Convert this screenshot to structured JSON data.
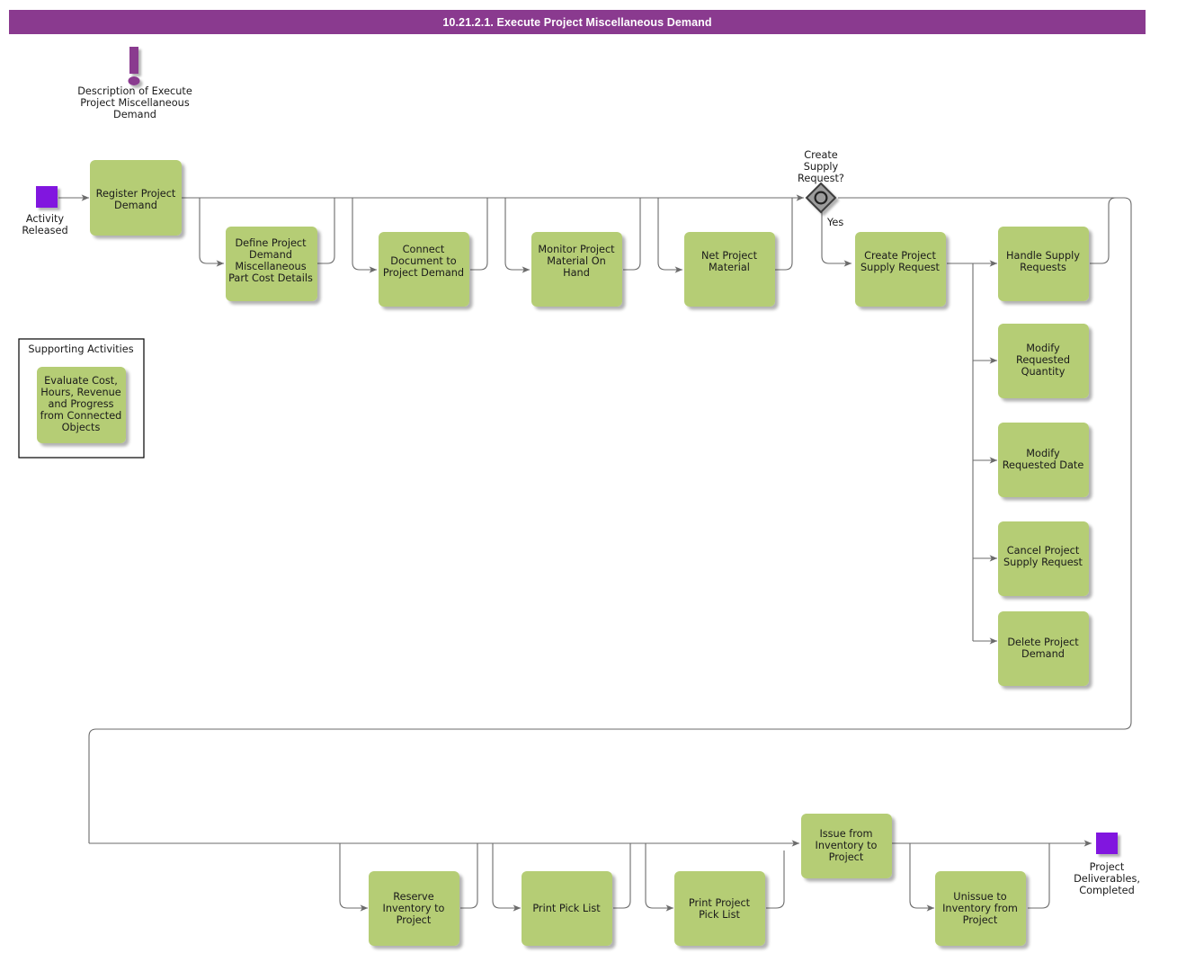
{
  "header": {
    "title": "10.21.2.1. Execute Project Miscellaneous Demand",
    "bar_color": "#8A3A8F",
    "text_color": "#FFFFFF"
  },
  "theme": {
    "task_fill": "#B5CD74",
    "event_fill": "#8117DF",
    "gateway_fill": "#9C9C9C",
    "gateway_stroke": "#3C3C3C",
    "line_color": "#6B6B6B",
    "annotation_color": "#8A3A8F",
    "background": "#FFFFFF"
  },
  "annotation": {
    "icon": "exclamation-mark-icon",
    "label": "Description of Execute Project Miscellaneous Demand",
    "lines": [
      "Description of Execute",
      "Project Miscellaneous",
      "Demand"
    ]
  },
  "start_event": {
    "name": "activity-released",
    "label": "Activity Released",
    "lines": [
      "Activity",
      "Released"
    ]
  },
  "end_event": {
    "name": "project-deliverables-completed",
    "label": "Project Deliverables, Completed",
    "lines": [
      "Project",
      "Deliverables,",
      "Completed"
    ]
  },
  "gateway": {
    "name": "create-supply-request-gateway",
    "label": "Create Supply Request?",
    "lines": [
      "Create",
      "Supply",
      "Request?"
    ],
    "type": "inclusive-or",
    "branch_label": "Yes"
  },
  "supporting_group": {
    "title": "Supporting Activities",
    "tasks": [
      {
        "id": "evaluate-cost-hours-revenue-progress",
        "label": "Evaluate Cost, Hours, Revenue and Progress from Connected Objects",
        "lines": [
          "Evaluate Cost,",
          "Hours, Revenue",
          "and Progress",
          "from Connected",
          "Objects"
        ]
      }
    ]
  },
  "tasks": [
    {
      "id": "register-project-demand",
      "label": "Register Project Demand",
      "lines": [
        "Register Project",
        "Demand"
      ]
    },
    {
      "id": "define-project-demand-misc-part-cost-details",
      "label": "Define Project Demand Miscellaneous Part Cost Details",
      "lines": [
        "Define Project",
        "Demand",
        "Miscellaneous",
        "Part Cost Details"
      ]
    },
    {
      "id": "connect-document-to-project-demand",
      "label": "Connect Document to Project Demand",
      "lines": [
        "Connect",
        "Document to",
        "Project Demand"
      ]
    },
    {
      "id": "monitor-project-material-on-hand",
      "label": "Monitor Project Material On Hand",
      "lines": [
        "Monitor Project",
        "Material On",
        "Hand"
      ]
    },
    {
      "id": "net-project-material",
      "label": "Net Project Material",
      "lines": [
        "Net Project",
        "Material"
      ]
    },
    {
      "id": "create-project-supply-request",
      "label": "Create Project Supply Request",
      "lines": [
        "Create Project",
        "Supply Request"
      ]
    },
    {
      "id": "handle-supply-requests",
      "label": "Handle Supply Requests",
      "lines": [
        "Handle Supply",
        "Requests"
      ]
    },
    {
      "id": "modify-requested-quantity",
      "label": "Modify Requested Quantity",
      "lines": [
        "Modify",
        "Requested",
        "Quantity"
      ]
    },
    {
      "id": "modify-requested-date",
      "label": "Modify Requested Date",
      "lines": [
        "Modify",
        "Requested Date"
      ]
    },
    {
      "id": "cancel-project-supply-request",
      "label": "Cancel Project Supply Request",
      "lines": [
        "Cancel Project",
        "Supply Request"
      ]
    },
    {
      "id": "delete-project-demand",
      "label": "Delete Project Demand",
      "lines": [
        "Delete Project",
        "Demand"
      ]
    },
    {
      "id": "reserve-inventory-to-project",
      "label": "Reserve Inventory to Project",
      "lines": [
        "Reserve",
        "Inventory to",
        "Project"
      ]
    },
    {
      "id": "print-pick-list",
      "label": "Print Pick List",
      "lines": [
        "Print Pick List"
      ]
    },
    {
      "id": "print-project-pick-list",
      "label": "Print Project Pick List",
      "lines": [
        "Print Project",
        "Pick List"
      ]
    },
    {
      "id": "issue-from-inventory-to-project",
      "label": "Issue from Inventory to Project",
      "lines": [
        "Issue from",
        "Inventory to",
        "Project"
      ]
    },
    {
      "id": "unissue-to-inventory-from-project",
      "label": "Unissue to Inventory from Project",
      "lines": [
        "Unissue to",
        "Inventory from",
        "Project"
      ]
    }
  ]
}
